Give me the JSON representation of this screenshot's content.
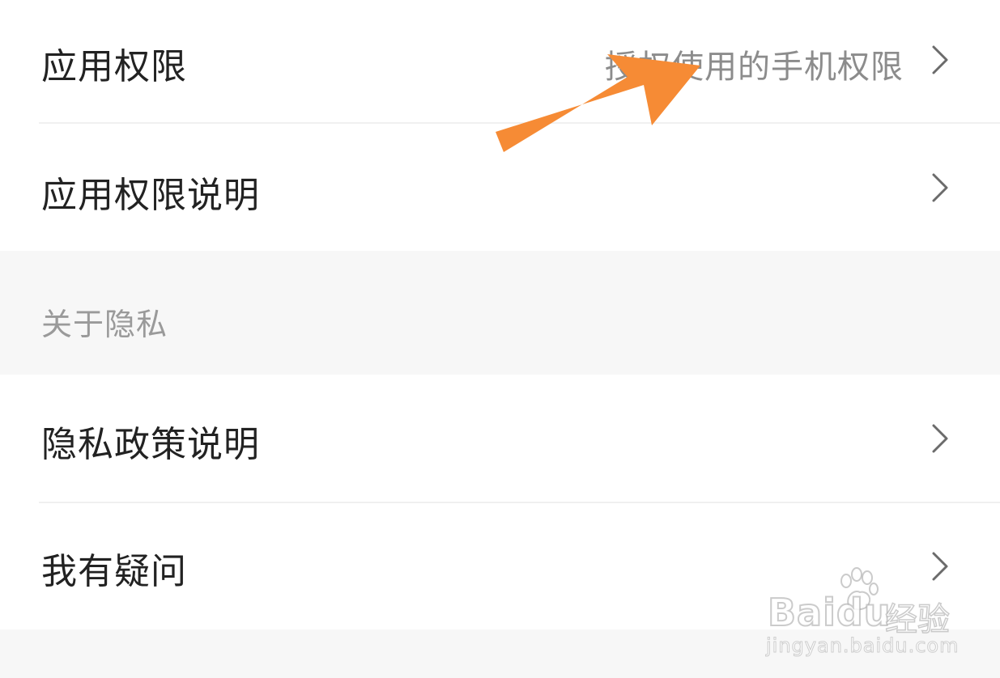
{
  "settings": {
    "permissions": {
      "items": [
        {
          "label": "应用权限",
          "value": "授权使用的手机权限"
        },
        {
          "label": "应用权限说明",
          "value": ""
        }
      ]
    },
    "privacy": {
      "header": "关于隐私",
      "items": [
        {
          "label": "隐私政策说明"
        },
        {
          "label": "我有疑问"
        }
      ]
    }
  },
  "annotation": {
    "arrow_color": "#f68b35"
  },
  "watermark": {
    "brand": "Baidu",
    "sub": "经验",
    "url": "jingyan.baidu.com"
  },
  "icons": {
    "row_chevron": "chevron-right-icon",
    "annotation": "arrow-icon",
    "watermark_logo": "paw-icon"
  }
}
